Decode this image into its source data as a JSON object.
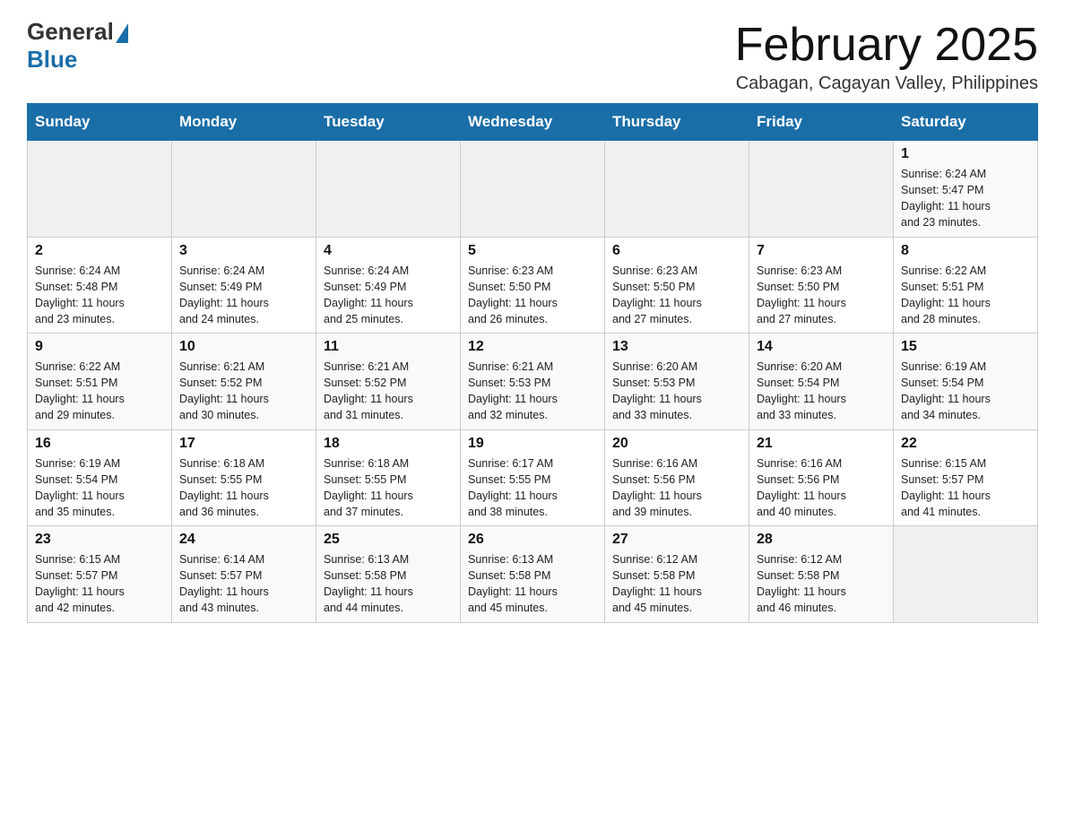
{
  "header": {
    "logo_general": "General",
    "logo_blue": "Blue",
    "month_title": "February 2025",
    "location": "Cabagan, Cagayan Valley, Philippines"
  },
  "days_of_week": [
    "Sunday",
    "Monday",
    "Tuesday",
    "Wednesday",
    "Thursday",
    "Friday",
    "Saturday"
  ],
  "weeks": [
    [
      {
        "day": "",
        "info": ""
      },
      {
        "day": "",
        "info": ""
      },
      {
        "day": "",
        "info": ""
      },
      {
        "day": "",
        "info": ""
      },
      {
        "day": "",
        "info": ""
      },
      {
        "day": "",
        "info": ""
      },
      {
        "day": "1",
        "info": "Sunrise: 6:24 AM\nSunset: 5:47 PM\nDaylight: 11 hours\nand 23 minutes."
      }
    ],
    [
      {
        "day": "2",
        "info": "Sunrise: 6:24 AM\nSunset: 5:48 PM\nDaylight: 11 hours\nand 23 minutes."
      },
      {
        "day": "3",
        "info": "Sunrise: 6:24 AM\nSunset: 5:49 PM\nDaylight: 11 hours\nand 24 minutes."
      },
      {
        "day": "4",
        "info": "Sunrise: 6:24 AM\nSunset: 5:49 PM\nDaylight: 11 hours\nand 25 minutes."
      },
      {
        "day": "5",
        "info": "Sunrise: 6:23 AM\nSunset: 5:50 PM\nDaylight: 11 hours\nand 26 minutes."
      },
      {
        "day": "6",
        "info": "Sunrise: 6:23 AM\nSunset: 5:50 PM\nDaylight: 11 hours\nand 27 minutes."
      },
      {
        "day": "7",
        "info": "Sunrise: 6:23 AM\nSunset: 5:50 PM\nDaylight: 11 hours\nand 27 minutes."
      },
      {
        "day": "8",
        "info": "Sunrise: 6:22 AM\nSunset: 5:51 PM\nDaylight: 11 hours\nand 28 minutes."
      }
    ],
    [
      {
        "day": "9",
        "info": "Sunrise: 6:22 AM\nSunset: 5:51 PM\nDaylight: 11 hours\nand 29 minutes."
      },
      {
        "day": "10",
        "info": "Sunrise: 6:21 AM\nSunset: 5:52 PM\nDaylight: 11 hours\nand 30 minutes."
      },
      {
        "day": "11",
        "info": "Sunrise: 6:21 AM\nSunset: 5:52 PM\nDaylight: 11 hours\nand 31 minutes."
      },
      {
        "day": "12",
        "info": "Sunrise: 6:21 AM\nSunset: 5:53 PM\nDaylight: 11 hours\nand 32 minutes."
      },
      {
        "day": "13",
        "info": "Sunrise: 6:20 AM\nSunset: 5:53 PM\nDaylight: 11 hours\nand 33 minutes."
      },
      {
        "day": "14",
        "info": "Sunrise: 6:20 AM\nSunset: 5:54 PM\nDaylight: 11 hours\nand 33 minutes."
      },
      {
        "day": "15",
        "info": "Sunrise: 6:19 AM\nSunset: 5:54 PM\nDaylight: 11 hours\nand 34 minutes."
      }
    ],
    [
      {
        "day": "16",
        "info": "Sunrise: 6:19 AM\nSunset: 5:54 PM\nDaylight: 11 hours\nand 35 minutes."
      },
      {
        "day": "17",
        "info": "Sunrise: 6:18 AM\nSunset: 5:55 PM\nDaylight: 11 hours\nand 36 minutes."
      },
      {
        "day": "18",
        "info": "Sunrise: 6:18 AM\nSunset: 5:55 PM\nDaylight: 11 hours\nand 37 minutes."
      },
      {
        "day": "19",
        "info": "Sunrise: 6:17 AM\nSunset: 5:55 PM\nDaylight: 11 hours\nand 38 minutes."
      },
      {
        "day": "20",
        "info": "Sunrise: 6:16 AM\nSunset: 5:56 PM\nDaylight: 11 hours\nand 39 minutes."
      },
      {
        "day": "21",
        "info": "Sunrise: 6:16 AM\nSunset: 5:56 PM\nDaylight: 11 hours\nand 40 minutes."
      },
      {
        "day": "22",
        "info": "Sunrise: 6:15 AM\nSunset: 5:57 PM\nDaylight: 11 hours\nand 41 minutes."
      }
    ],
    [
      {
        "day": "23",
        "info": "Sunrise: 6:15 AM\nSunset: 5:57 PM\nDaylight: 11 hours\nand 42 minutes."
      },
      {
        "day": "24",
        "info": "Sunrise: 6:14 AM\nSunset: 5:57 PM\nDaylight: 11 hours\nand 43 minutes."
      },
      {
        "day": "25",
        "info": "Sunrise: 6:13 AM\nSunset: 5:58 PM\nDaylight: 11 hours\nand 44 minutes."
      },
      {
        "day": "26",
        "info": "Sunrise: 6:13 AM\nSunset: 5:58 PM\nDaylight: 11 hours\nand 45 minutes."
      },
      {
        "day": "27",
        "info": "Sunrise: 6:12 AM\nSunset: 5:58 PM\nDaylight: 11 hours\nand 45 minutes."
      },
      {
        "day": "28",
        "info": "Sunrise: 6:12 AM\nSunset: 5:58 PM\nDaylight: 11 hours\nand 46 minutes."
      },
      {
        "day": "",
        "info": ""
      }
    ]
  ]
}
